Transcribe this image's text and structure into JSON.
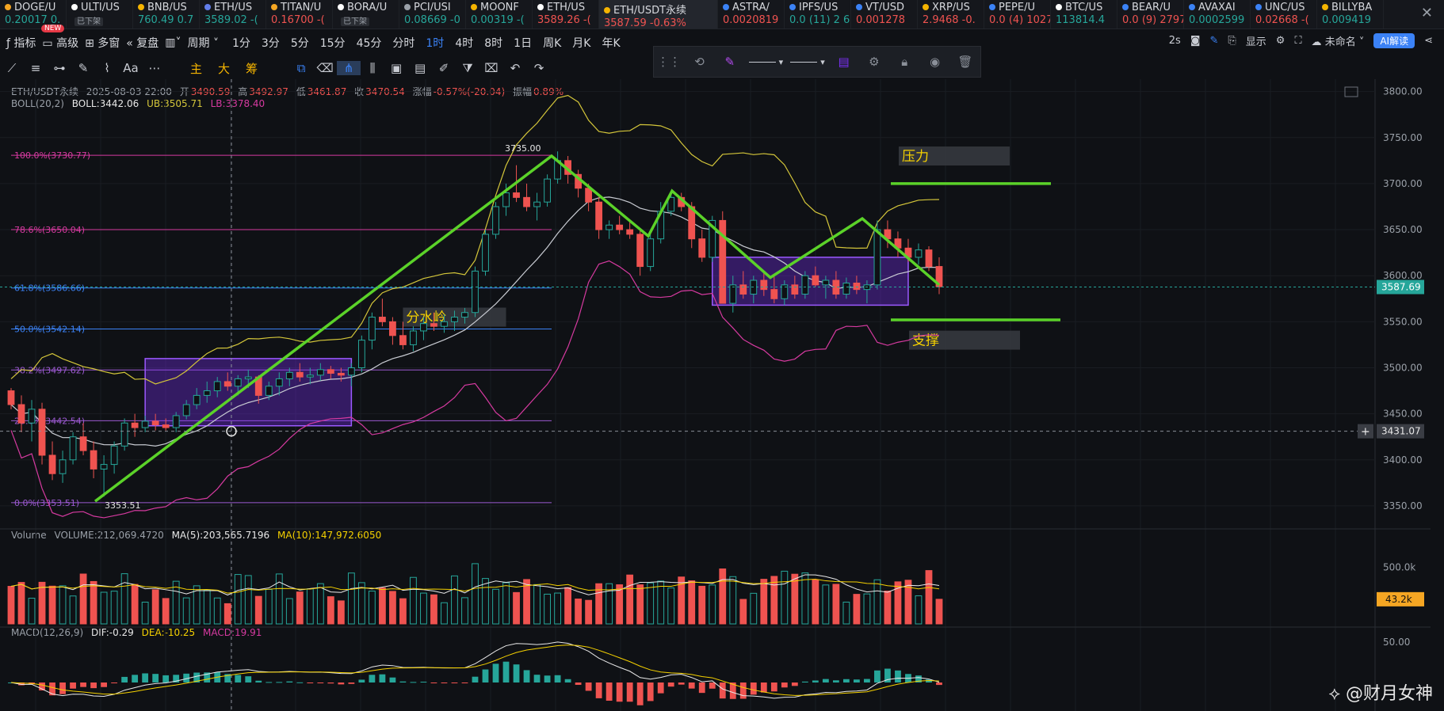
{
  "tabs": [
    {
      "name": "DOGE/U",
      "price": "0.20017",
      "pct": "0.",
      "dot": "#f5a623",
      "up": true
    },
    {
      "name": "ULTI/US",
      "price": "",
      "pct": "",
      "dot": "#ffffff",
      "badge": "已下架",
      "up": true
    },
    {
      "name": "BNB/US",
      "price": "760.49",
      "pct": "0.7",
      "dot": "#f5b400",
      "up": true
    },
    {
      "name": "ETH/US",
      "price": "3589.02",
      "pct": "-(",
      "dot": "#627eea",
      "up": true
    },
    {
      "name": "TITAN/U",
      "price": "0.16700",
      "pct": "-(",
      "dot": "#f5a623",
      "up": false
    },
    {
      "name": "BORA/U",
      "price": "",
      "pct": "",
      "dot": "#ffffff",
      "badge": "已下架",
      "up": true
    },
    {
      "name": "PCI/USI",
      "price": "0.08669",
      "pct": "-0",
      "dot": "#9aa0a8",
      "up": true
    },
    {
      "name": "MOONF",
      "price": "0.00319",
      "pct": "-(",
      "dot": "#f5b400",
      "up": true
    },
    {
      "name": "ETH/US",
      "price": "3589.26",
      "pct": "-(",
      "dot": "#ffffff",
      "up": false
    },
    {
      "name": "ETH/USDT永续",
      "price": "3587.59",
      "pct": "-0.63%",
      "dot": "#f5b400",
      "active": true,
      "up": false
    },
    {
      "name": "ASTRA/",
      "price": "0.0020819",
      "pct": "",
      "dot": "#3b82f6",
      "up": false
    },
    {
      "name": "IPFS/US",
      "price": "0.0",
      "pct": "(11) 2 6",
      "dot": "#3b82f6",
      "up": true
    },
    {
      "name": "VT/USD",
      "price": "0.001278",
      "pct": "",
      "dot": "#3b82f6",
      "up": false
    },
    {
      "name": "XRP/US",
      "price": "2.9468",
      "pct": "-0.",
      "dot": "#f5b400",
      "up": false
    },
    {
      "name": "PEPE/U",
      "price": "0.0",
      "pct": "(4) 1027",
      "dot": "#3b82f6",
      "up": false
    },
    {
      "name": "BTC/US",
      "price": "113814.4",
      "pct": "",
      "dot": "#ffffff",
      "up": true
    },
    {
      "name": "BEAR/U",
      "price": "0.0",
      "pct": "(9) 2797",
      "dot": "#3b82f6",
      "up": false
    },
    {
      "name": "AVAXAI",
      "price": "0.0002599",
      "pct": "",
      "dot": "#3b82f6",
      "up": true
    },
    {
      "name": "UNC/US",
      "price": "0.02668",
      "pct": "-(",
      "dot": "#3b82f6",
      "up": false
    },
    {
      "name": "BILLYBA",
      "price": "0.009419",
      "pct": "",
      "dot": "#f5b400",
      "up": true
    }
  ],
  "toolbar1": {
    "items": [
      "指标",
      "高级",
      "多窗",
      "复盘",
      "周期"
    ],
    "new_badge": "NEW",
    "timeframes": [
      "1分",
      "3分",
      "5分",
      "15分",
      "45分",
      "分时",
      "1时",
      "4时",
      "8时",
      "1日",
      "周K",
      "月K",
      "年K"
    ],
    "selected": "1时",
    "right": {
      "refresh": "2s",
      "display": "显示",
      "unnamed": "未命名",
      "ai": "AI解读"
    }
  },
  "toolbar2": {
    "left_icons": [
      "trend-line-icon",
      "horizontal-lines-icon",
      "ray-icon",
      "pen-icon",
      "wave-icon",
      "text-icon",
      "more-icon"
    ],
    "center_labels": [
      "主",
      "大",
      "筹"
    ],
    "right_icons": [
      "layers-icon",
      "eraser-icon",
      "magnet-icon",
      "compare-icon",
      "calendar-icon",
      "note-icon",
      "brush-icon",
      "filter-icon",
      "trash-icon",
      "undo-icon",
      "redo-icon"
    ]
  },
  "ohlc": {
    "symbol": "ETH/USDT永续",
    "time": "2025-08-03 22:00",
    "open_label": "开",
    "open": "3490.59",
    "high_label": "高",
    "high": "3492.97",
    "low_label": "低",
    "low": "3461.87",
    "close_label": "收",
    "close": "3470.54",
    "chg_label": "涨幅",
    "chg": "-0.57%(-20.04)",
    "amp_label": "振幅",
    "amp": "0.89%"
  },
  "boll_legend": {
    "name": "BOLL(20,2)",
    "boll": "BOLL:3442.06",
    "ub": "UB:3505.71",
    "lb": "LB:3378.40"
  },
  "volume_legend": {
    "name": "Volume",
    "vol": "VOLUME:212,069.4720",
    "ma5": "MA(5):203,565.7196",
    "ma10": "MA(10):147,972.6050"
  },
  "macd_legend": {
    "name": "MACD(12,26,9)",
    "dif": "DIF:-0.29",
    "dea": "DEA:-10.25",
    "macd": "MACD:19.91"
  },
  "colors": {
    "up": "#26a69a",
    "down": "#ef5350",
    "green_line": "#5bd229",
    "boll_ub": "#d4c63a",
    "boll_mid": "#c9ccd3",
    "boll_lb": "#d63aa0",
    "fib_box": "#7b2ff7",
    "price_tag": "#26a69a"
  },
  "chart_data": {
    "type": "candlestick",
    "price_axis": {
      "min": 3325,
      "max": 3810,
      "ticks": [
        3350,
        3400,
        3450,
        3500,
        3550,
        3600,
        3650,
        3700,
        3750,
        3800
      ]
    },
    "last_price": "3587.69",
    "crosshair_price": "3431.07",
    "fib_levels": [
      {
        "label": "100.0%(3730.77)",
        "price": 3730.77,
        "color": "#d63aa0"
      },
      {
        "label": "78.6%(3650.04)",
        "price": 3650.04,
        "color": "#d63aa0"
      },
      {
        "label": "61.8%(3586.66)",
        "price": 3586.66,
        "color": "#3b82f6"
      },
      {
        "label": "50.0%(3542.14)",
        "price": 3542.14,
        "color": "#3b82f6"
      },
      {
        "label": "38.2%(3497.62)",
        "price": 3497.62,
        "color": "#9b59d0"
      },
      {
        "label": "23.6%(3442.54)",
        "price": 3442.54,
        "color": "#9b59d0"
      },
      {
        "label": "0.0%(3353.51)",
        "price": 3353.51,
        "color": "#9b59d0"
      }
    ],
    "annotations": [
      {
        "text": "3735.00",
        "type": "high"
      },
      {
        "text": "3353.51",
        "type": "low"
      },
      {
        "text": "分水岭",
        "type": "label"
      },
      {
        "text": "压力",
        "type": "label"
      },
      {
        "text": "支撑",
        "type": "label"
      }
    ],
    "candles": [
      [
        3475,
        3478,
        3455,
        3460
      ],
      [
        3460,
        3470,
        3430,
        3440
      ],
      [
        3440,
        3465,
        3420,
        3455
      ],
      [
        3455,
        3462,
        3395,
        3405
      ],
      [
        3405,
        3420,
        3378,
        3385
      ],
      [
        3385,
        3410,
        3375,
        3400
      ],
      [
        3400,
        3430,
        3395,
        3425
      ],
      [
        3425,
        3440,
        3405,
        3410
      ],
      [
        3410,
        3420,
        3380,
        3390
      ],
      [
        3390,
        3405,
        3360,
        3395
      ],
      [
        3395,
        3420,
        3385,
        3415
      ],
      [
        3415,
        3445,
        3410,
        3440
      ],
      [
        3440,
        3450,
        3425,
        3435
      ],
      [
        3435,
        3448,
        3430,
        3442
      ],
      [
        3442,
        3450,
        3432,
        3438
      ],
      [
        3438,
        3445,
        3432,
        3435
      ],
      [
        3435,
        3452,
        3430,
        3448
      ],
      [
        3448,
        3465,
        3444,
        3460
      ],
      [
        3460,
        3478,
        3455,
        3470
      ],
      [
        3470,
        3485,
        3462,
        3475
      ],
      [
        3475,
        3490,
        3468,
        3485
      ],
      [
        3485,
        3495,
        3475,
        3480
      ],
      [
        3480,
        3492,
        3470,
        3488
      ],
      [
        3488,
        3498,
        3478,
        3490
      ],
      [
        3490,
        3492,
        3461,
        3470
      ],
      [
        3470,
        3485,
        3465,
        3480
      ],
      [
        3480,
        3495,
        3470,
        3488
      ],
      [
        3488,
        3500,
        3480,
        3495
      ],
      [
        3495,
        3505,
        3485,
        3490
      ],
      [
        3490,
        3500,
        3482,
        3492
      ],
      [
        3492,
        3505,
        3486,
        3498
      ],
      [
        3498,
        3502,
        3488,
        3494
      ],
      [
        3494,
        3500,
        3485,
        3492
      ],
      [
        3492,
        3505,
        3480,
        3500
      ],
      [
        3500,
        3535,
        3495,
        3530
      ],
      [
        3530,
        3560,
        3520,
        3555
      ],
      [
        3555,
        3575,
        3545,
        3550
      ],
      [
        3550,
        3555,
        3525,
        3535
      ],
      [
        3535,
        3550,
        3520,
        3525
      ],
      [
        3525,
        3545,
        3518,
        3540
      ],
      [
        3540,
        3555,
        3530,
        3548
      ],
      [
        3548,
        3560,
        3540,
        3545
      ],
      [
        3545,
        3558,
        3538,
        3550
      ],
      [
        3550,
        3562,
        3540,
        3555
      ],
      [
        3555,
        3565,
        3548,
        3560
      ],
      [
        3560,
        3610,
        3555,
        3605
      ],
      [
        3605,
        3650,
        3600,
        3645
      ],
      [
        3645,
        3680,
        3640,
        3675
      ],
      [
        3675,
        3700,
        3665,
        3690
      ],
      [
        3690,
        3720,
        3680,
        3685
      ],
      [
        3685,
        3700,
        3670,
        3675
      ],
      [
        3675,
        3690,
        3660,
        3680
      ],
      [
        3680,
        3710,
        3675,
        3705
      ],
      [
        3705,
        3735,
        3700,
        3725
      ],
      [
        3725,
        3730,
        3700,
        3710
      ],
      [
        3710,
        3715,
        3685,
        3695
      ],
      [
        3695,
        3700,
        3670,
        3680
      ],
      [
        3680,
        3685,
        3640,
        3650
      ],
      [
        3650,
        3660,
        3640,
        3655
      ],
      [
        3655,
        3665,
        3645,
        3650
      ],
      [
        3650,
        3660,
        3640,
        3645
      ],
      [
        3645,
        3650,
        3600,
        3610
      ],
      [
        3610,
        3645,
        3605,
        3640
      ],
      [
        3640,
        3680,
        3635,
        3670
      ],
      [
        3670,
        3690,
        3665,
        3685
      ],
      [
        3685,
        3690,
        3670,
        3675
      ],
      [
        3675,
        3680,
        3630,
        3640
      ],
      [
        3640,
        3650,
        3615,
        3620
      ],
      [
        3620,
        3665,
        3615,
        3660
      ],
      [
        3660,
        3670,
        3600,
        3570
      ],
      [
        3570,
        3600,
        3560,
        3590
      ],
      [
        3590,
        3605,
        3575,
        3580
      ],
      [
        3580,
        3600,
        3570,
        3595
      ],
      [
        3595,
        3605,
        3578,
        3585
      ],
      [
        3585,
        3600,
        3570,
        3575
      ],
      [
        3575,
        3595,
        3568,
        3590
      ],
      [
        3590,
        3600,
        3575,
        3580
      ],
      [
        3580,
        3605,
        3575,
        3600
      ],
      [
        3600,
        3610,
        3588,
        3590
      ],
      [
        3590,
        3600,
        3575,
        3595
      ],
      [
        3595,
        3605,
        3575,
        3580
      ],
      [
        3580,
        3598,
        3575,
        3592
      ],
      [
        3592,
        3600,
        3580,
        3585
      ],
      [
        3585,
        3595,
        3570,
        3590
      ],
      [
        3590,
        3660,
        3585,
        3650
      ],
      [
        3650,
        3660,
        3630,
        3640
      ],
      [
        3640,
        3648,
        3620,
        3630
      ],
      [
        3630,
        3640,
        3615,
        3620
      ],
      [
        3620,
        3635,
        3612,
        3628
      ],
      [
        3628,
        3632,
        3605,
        3610
      ],
      [
        3610,
        3620,
        3580,
        3588
      ]
    ],
    "volume": {
      "axis_label": "500.0k",
      "last": "43.2k",
      "max": 700000
    },
    "macd": {
      "axis_label": "50.00"
    }
  },
  "watermark": "@财月女神"
}
